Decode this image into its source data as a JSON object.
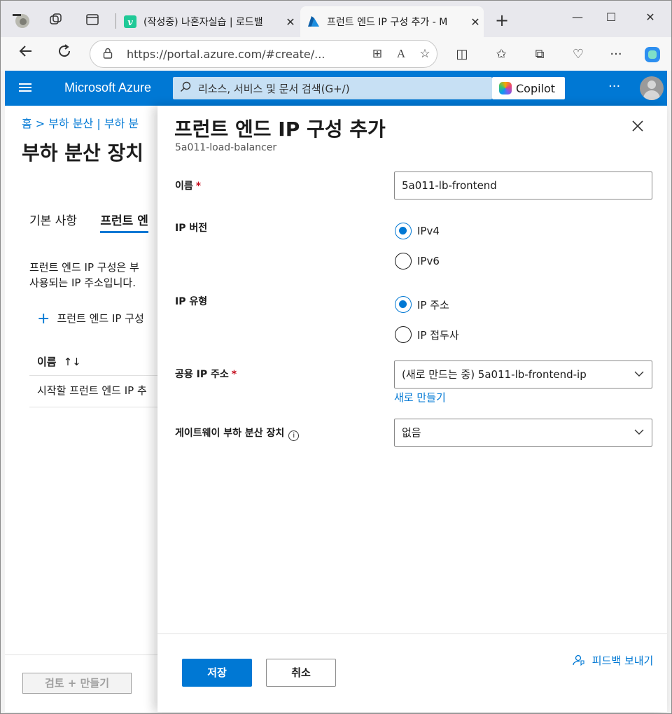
{
  "browser": {
    "tabs": [
      {
        "title": "(작성중) 나혼자실습 | 로드밸",
        "favicon": "velog-v-icon"
      },
      {
        "title": "프런트 엔드 IP 구성 추가 - M",
        "favicon": "azure-a-icon"
      }
    ],
    "url": "https://portal.azure.com/#create/..."
  },
  "azure": {
    "brand": "Microsoft Azure",
    "search_placeholder": "리소스, 서비스 및 문서 검색(G+/)",
    "copilot_label": "Copilot"
  },
  "background_page": {
    "breadcrumb": "홈 > 부하 분산 | 부하 분",
    "title": "부하 분산 장치",
    "tabs": [
      "기본 사항",
      "프런트 엔"
    ],
    "description_line1": "프런트 엔드 IP 구성은 부",
    "description_line2": "사용되는 IP 주소입니다.",
    "add_label": "프런트 엔드 IP 구성",
    "column_name": "이름",
    "column_sort": "↑↓",
    "empty_row": "시작할 프런트 엔드 IP 추",
    "review_button": "검토 + 만들기"
  },
  "blade": {
    "title": "프런트 엔드 IP 구성 추가",
    "subtitle": "5a011-load-balancer",
    "name_label": "이름",
    "name_value": "5a011-lb-frontend",
    "ip_version_label": "IP 버전",
    "ip_version_options": [
      "IPv4",
      "IPv6"
    ],
    "ip_type_label": "IP 유형",
    "ip_type_options": [
      "IP 주소",
      "IP 접두사"
    ],
    "public_ip_label": "공용 IP 주소",
    "public_ip_value": "(새로 만드는 중) 5a011-lb-frontend-ip",
    "create_new_link": "새로 만들기",
    "gateway_label": "게이트웨이 부하 분산 장치",
    "gateway_value": "없음",
    "save_button": "저장",
    "cancel_button": "취소",
    "feedback_link": "피드백 보내기"
  },
  "colors": {
    "azure_blue": "#0078d4",
    "search_bg": "#c7e0f4",
    "required_red": "#c50f1f"
  }
}
